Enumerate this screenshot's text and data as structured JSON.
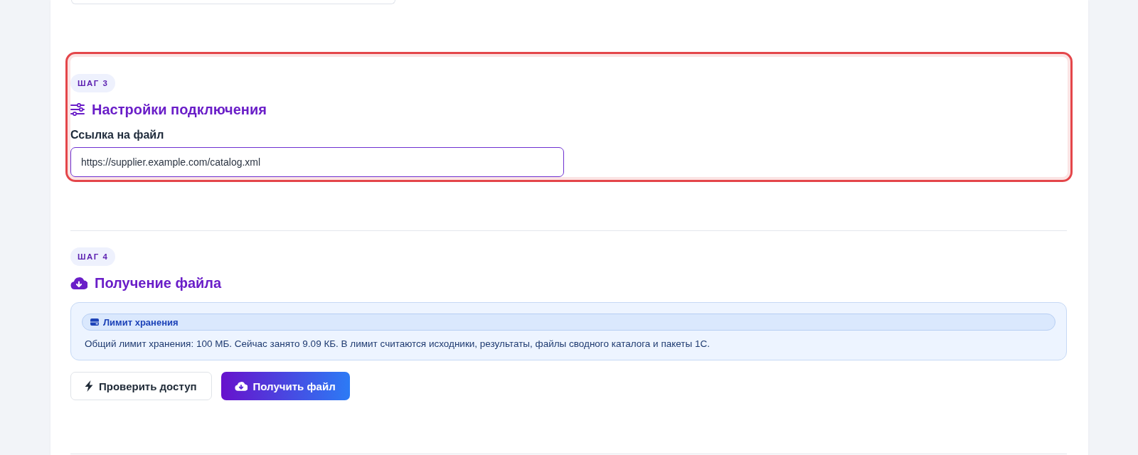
{
  "steps": [
    {
      "kind": "settings",
      "badge": "ШАГ 3",
      "title": "Настройки подключения",
      "highlighted": true,
      "field": {
        "label": "Ссылка на файл",
        "value": "https://supplier.example.com/catalog.xml",
        "focused": true
      }
    },
    {
      "kind": "fetch",
      "badge": "ШАГ 4",
      "title": "Получение файла",
      "highlighted": false,
      "notice": {
        "title": "Лимит хранения",
        "text": "Общий лимит хранения: 100 МБ. Сейчас занято 9.09 КБ. В лимит считаются исходники, результаты, файлы сводного каталога и пакеты 1С."
      },
      "buttons": [
        {
          "kind": "secondary",
          "label": "Проверить доступ"
        },
        {
          "kind": "primary",
          "label": "Получить файл"
        }
      ]
    }
  ]
}
